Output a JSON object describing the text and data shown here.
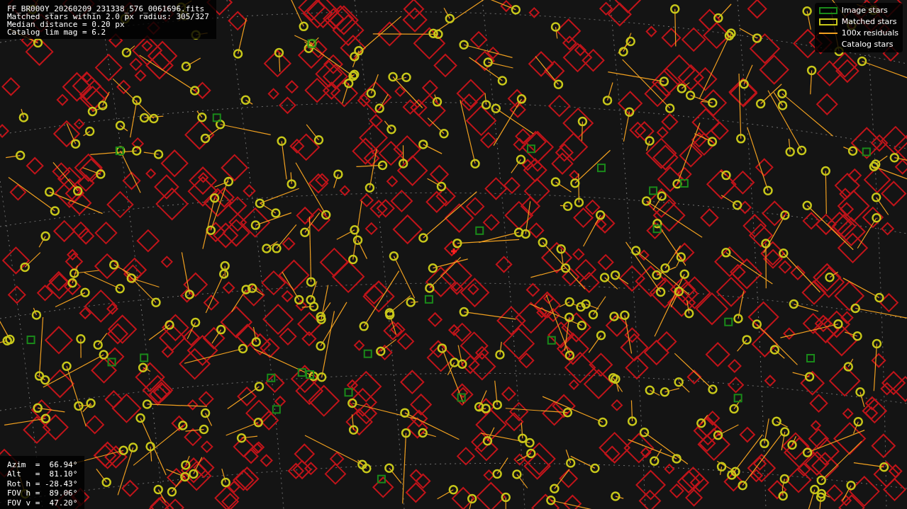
{
  "info": {
    "lines": [
      "FF_BR000Y_20260209_231338_576_0061696.fits",
      "Matched stars within 2.0 px radius: 305/327",
      "Median distance = 0.20 px",
      "Catalog lim mag = 6.2"
    ]
  },
  "legend": [
    {
      "label": "Image stars",
      "kind": "green-box"
    },
    {
      "label": "Matched stars",
      "kind": "yellow-box"
    },
    {
      "label": "100x residuals",
      "kind": "line"
    },
    {
      "label": "Catalog stars",
      "kind": "none"
    }
  ],
  "pointing": [
    "Azim  =  66.94°",
    "Alt   =  81.10°",
    "Rot h = -28.43°",
    "FOV h =  89.06°",
    "FOV v =  47.20°"
  ]
}
